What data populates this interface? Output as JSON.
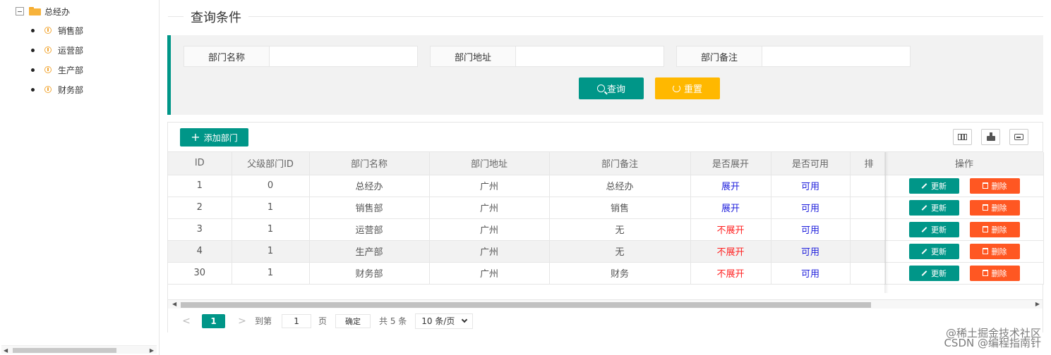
{
  "tree": {
    "root": "总经办",
    "children": [
      "销售部",
      "运营部",
      "生产部",
      "财务部"
    ]
  },
  "query": {
    "title": "查询条件",
    "fields": [
      {
        "label": "部门名称",
        "value": ""
      },
      {
        "label": "部门地址",
        "value": ""
      },
      {
        "label": "部门备注",
        "value": ""
      }
    ],
    "search_label": "查询",
    "reset_label": "重置"
  },
  "toolbar": {
    "add_label": "添加部门",
    "icons": [
      "columns-icon",
      "export-icon",
      "print-icon"
    ]
  },
  "table": {
    "headers": [
      "ID",
      "父级部门ID",
      "部门名称",
      "部门地址",
      "部门备注",
      "是否展开",
      "是否可用",
      "排",
      "操作"
    ],
    "rows": [
      {
        "id": "1",
        "parent": "0",
        "name": "总经办",
        "address": "广州",
        "note": "总经办",
        "expand": "展开",
        "enabled": "可用"
      },
      {
        "id": "2",
        "parent": "1",
        "name": "销售部",
        "address": "广州",
        "note": "销售",
        "expand": "展开",
        "enabled": "可用"
      },
      {
        "id": "3",
        "parent": "1",
        "name": "运营部",
        "address": "广州",
        "note": "无",
        "expand": "不展开",
        "enabled": "可用"
      },
      {
        "id": "4",
        "parent": "1",
        "name": "生产部",
        "address": "广州",
        "note": "无",
        "expand": "不展开",
        "enabled": "可用"
      },
      {
        "id": "30",
        "parent": "1",
        "name": "财务部",
        "address": "广州",
        "note": "财务",
        "expand": "不展开",
        "enabled": "可用"
      }
    ],
    "update_label": "更新",
    "delete_label": "删除"
  },
  "pager": {
    "current_page": "1",
    "goto_prefix": "到第",
    "goto_value": "1",
    "goto_suffix": "页",
    "confirm_label": "确定",
    "total_text": "共 5 条",
    "page_size": "10 条/页"
  },
  "watermark": {
    "line1": "@稀土掘金技术社区",
    "line2": "CSDN @编程指南针"
  },
  "colors": {
    "primary": "#009688",
    "warning": "#ffb800",
    "danger": "#ff5722",
    "expand_blue": "#1e1edc",
    "collapse_red": "#ff2222"
  }
}
